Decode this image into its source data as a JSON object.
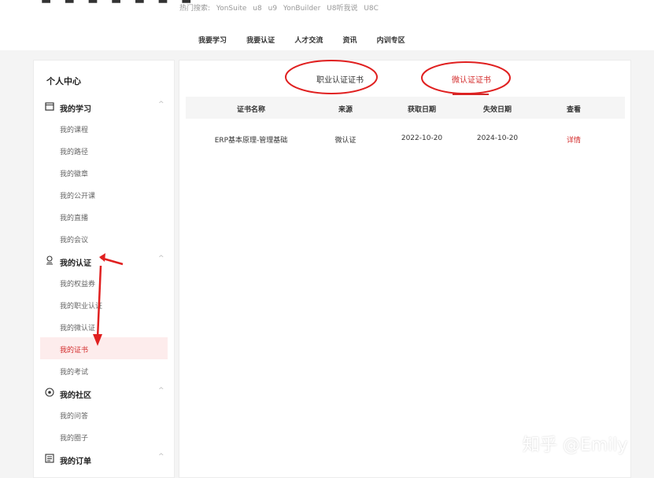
{
  "header": {
    "hot_label": "热门搜索:",
    "hot_terms": [
      "YonSuite",
      "u8",
      "u9",
      "YonBuilder",
      "U8听我说",
      "U8C"
    ],
    "nav": [
      "我要学习",
      "我要认证",
      "人才交流",
      "资讯",
      "内训专区"
    ]
  },
  "sidebar": {
    "title": "个人中心",
    "groups": [
      {
        "label": "我的学习",
        "icon": "calendar-icon",
        "items": [
          "我的课程",
          "我的路径",
          "我的徽章",
          "我的公开课",
          "我的直播",
          "我的会议"
        ]
      },
      {
        "label": "我的认证",
        "icon": "certificate-icon",
        "items": [
          "我的权益券",
          "我的职业认证",
          "我的微认证",
          "我的证书",
          "我的考试"
        ]
      },
      {
        "label": "我的社区",
        "icon": "community-icon",
        "items": [
          "我的问答",
          "我的圈子"
        ]
      },
      {
        "label": "我的订单",
        "icon": "order-icon",
        "items": []
      }
    ],
    "active_item": "我的证书"
  },
  "main": {
    "tabs": [
      {
        "label": "职业认证证书",
        "active": false
      },
      {
        "label": "微认证证书",
        "active": true
      }
    ],
    "columns": [
      "证书名称",
      "来源",
      "获取日期",
      "失效日期",
      "查看"
    ],
    "rows": [
      {
        "name": "ERP基本原理-管理基础",
        "source": "微认证",
        "acquired": "2022-10-20",
        "expires": "2024-10-20",
        "action": "详情"
      }
    ]
  },
  "watermark": "知乎 @Emily",
  "colors": {
    "accent": "#d32b2b",
    "active_bg": "#fdecec",
    "page_bg": "#f4f4f4"
  }
}
